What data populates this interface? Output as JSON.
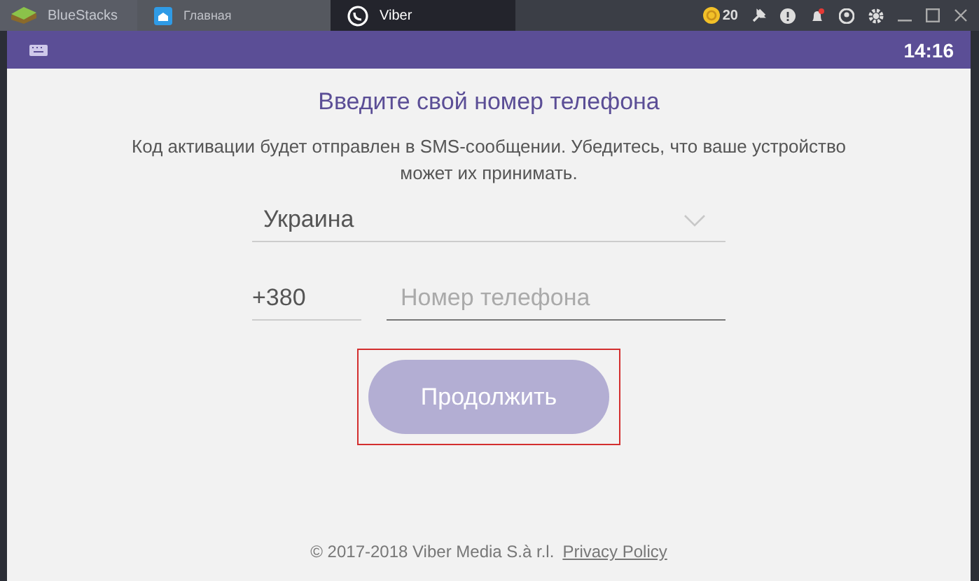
{
  "window": {
    "app_name": "BlueStacks",
    "coins": "20"
  },
  "tabs": [
    {
      "label": "Главная",
      "selected": false
    },
    {
      "label": "Viber",
      "selected": true
    }
  ],
  "status_bar": {
    "time": "14:16"
  },
  "title": "Введите свой номер телефона",
  "description": "Код активации будет отправлен в SMS-сообщении. Убедитесь, что ваше устройство может их принимать.",
  "country": {
    "value": "Украина"
  },
  "phone": {
    "code": "+380",
    "placeholder": "Номер телефона"
  },
  "continue_button": {
    "label": "Продолжить",
    "disabled": true,
    "highlighted": true
  },
  "footer": {
    "copyright": "© 2017-2018 Viber Media S.à r.l.",
    "link": "Privacy Policy"
  }
}
